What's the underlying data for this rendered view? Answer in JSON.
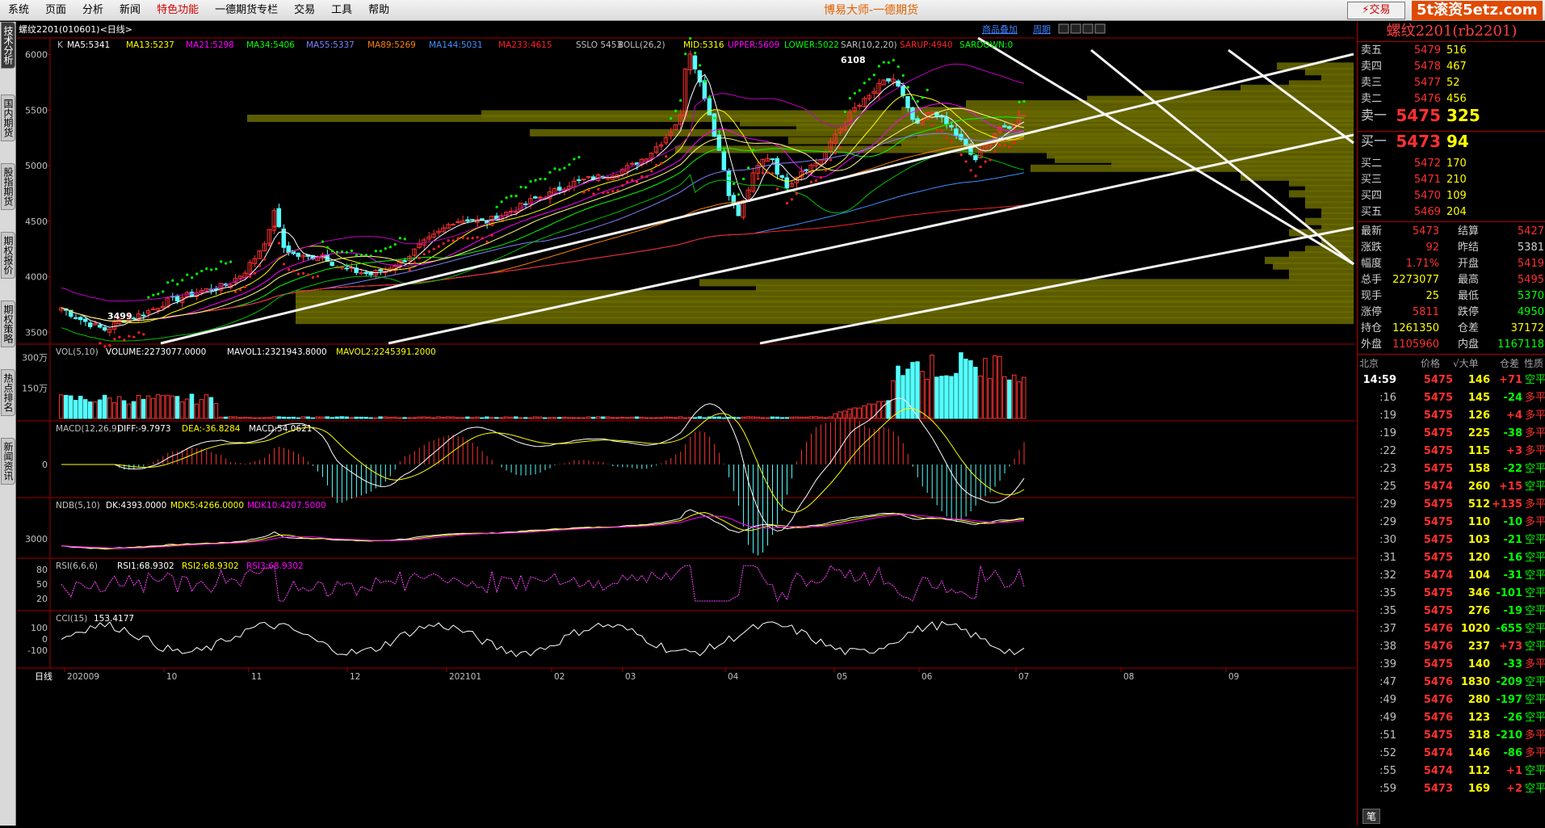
{
  "menu": [
    "系统",
    "页面",
    "分析",
    "新闻",
    "特色功能",
    "一德期货专栏",
    "交易",
    "工具",
    "帮助"
  ],
  "menu_active": 4,
  "app_title": "博易大师-一德期货",
  "trade_button": "⚡交易",
  "watermark": "5t滚资5etz.com",
  "side_tabs": [
    "技术分析",
    "国内期货",
    "股指期货",
    "期权报价",
    "期权策略",
    "热点排名",
    "新闻资讯"
  ],
  "chart": {
    "instrument_label": "螺纹2201(010601)<日线>",
    "toolbar_link": "商品叠加",
    "toolbar_link2": "周期",
    "main_indicator": {
      "k": "K",
      "ma5": "MA5:5341",
      "ma13": "MA13:5237",
      "ma21": "MA21:5298",
      "ma34": "MA34:5406",
      "ma55": "MA55:5337",
      "ma89": "MA89:5269",
      "ma144": "MA144:5031",
      "ma233": "MA233:4615",
      "sslo": "SSLO 5453",
      "boll": "BOLL(26,2)",
      "mid": "MID:5316",
      "upper": "UPPER:5609",
      "lower": "LOWER:5022",
      "sar": "SAR(10,2,20)",
      "sarup": "SARUP:4940",
      "sardown": "SARDOWN:0"
    },
    "high_label": "6108",
    "low_label": "3499",
    "price_axis": [
      "6000",
      "5500",
      "5000",
      "4500",
      "4000",
      "3500"
    ],
    "vol_header": {
      "title": "VOL(5,10)",
      "volume": "VOLUME:2273077.0000",
      "mavol1": "MAVOL1:2321943.8000",
      "mavol2": "MAVOL2:2245391.2000"
    },
    "vol_axis": [
      "300万",
      "150万"
    ],
    "macd_header": {
      "title": "MACD(12,26,9)",
      "diff": "DIFF:-9.7973",
      "dea": "DEA:-36.8284",
      "macd": "MACD:54.0621"
    },
    "macd_axis": [
      "0"
    ],
    "ndb_header": {
      "title": "NDB(5,10)",
      "dk": "DK:4393.0000",
      "mdk5": "MDK5:4266.0000",
      "mdk10": "MDK10:4207.5000"
    },
    "ndb_axis": [
      "3000"
    ],
    "rsi_header": {
      "title": "RSI(6,6,6)",
      "rsi1": "RSI1:68.9302",
      "rsi2": "RSI2:68.9302",
      "rsi3": "RSI3:68.9302"
    },
    "rsi_axis": [
      "80",
      "50",
      "20"
    ],
    "cci_header": {
      "title": "CCI(15)",
      "value": "153.4177"
    },
    "cci_axis": [
      "100",
      "0",
      "-100"
    ],
    "period_label": "日线",
    "date_axis": [
      "202009",
      "10",
      "11",
      "12",
      "202101",
      "02",
      "03",
      "04",
      "05",
      "06",
      "07",
      "08",
      "09"
    ]
  },
  "chart_data": {
    "type": "candlestick",
    "ylim": [
      3400,
      6150
    ],
    "high": 6108,
    "low": 3499,
    "last_close": 5473
  },
  "quote": {
    "title": "螺纹2201(rb2201)",
    "asks": [
      {
        "label": "卖五",
        "price": "5479",
        "vol": "516"
      },
      {
        "label": "卖四",
        "price": "5478",
        "vol": "467"
      },
      {
        "label": "卖三",
        "price": "5477",
        "vol": "52"
      },
      {
        "label": "卖二",
        "price": "5476",
        "vol": "456"
      },
      {
        "label": "卖一",
        "price": "5475",
        "vol": "325"
      }
    ],
    "bids": [
      {
        "label": "买一",
        "price": "5473",
        "vol": "94"
      },
      {
        "label": "买二",
        "price": "5472",
        "vol": "170"
      },
      {
        "label": "买三",
        "price": "5471",
        "vol": "210"
      },
      {
        "label": "买四",
        "price": "5470",
        "vol": "109"
      },
      {
        "label": "买五",
        "price": "5469",
        "vol": "204"
      }
    ],
    "stats": [
      {
        "l1": "最新",
        "v1": "5473",
        "c1": "up",
        "l2": "结算",
        "v2": "5427",
        "c2": "up"
      },
      {
        "l1": "涨跌",
        "v1": "92",
        "c1": "up",
        "l2": "昨结",
        "v2": "5381",
        "c2": "wh"
      },
      {
        "l1": "幅度",
        "v1": "1.71%",
        "c1": "up",
        "l2": "开盘",
        "v2": "5419",
        "c2": "up"
      },
      {
        "l1": "总手",
        "v1": "2273077",
        "c1": "ye",
        "l2": "最高",
        "v2": "5495",
        "c2": "up"
      },
      {
        "l1": "现手",
        "v1": "25",
        "c1": "ye",
        "l2": "最低",
        "v2": "5370",
        "c2": "gr"
      },
      {
        "l1": "涨停",
        "v1": "5811",
        "c1": "up",
        "l2": "跌停",
        "v2": "4950",
        "c2": "gr"
      },
      {
        "l1": "持仓",
        "v1": "1261350",
        "c1": "ye",
        "l2": "仓差",
        "v2": "37172",
        "c2": "ye"
      },
      {
        "l1": "外盘",
        "v1": "1105960",
        "c1": "up",
        "l2": "内盘",
        "v2": "1167118",
        "c2": "gr"
      }
    ],
    "tick_header": {
      "loc": "北京",
      "price": "价格",
      "vol": "√大单",
      "oi": "仓差",
      "nat": "性质"
    },
    "ticks": [
      {
        "t": "14:59",
        "p": "5475",
        "v": "146",
        "o": "+71",
        "n": "空平"
      },
      {
        "t": ":16",
        "p": "5475",
        "v": "145",
        "o": "-24",
        "n": "多平"
      },
      {
        "t": ":19",
        "p": "5475",
        "v": "126",
        "o": "+4",
        "n": "多平"
      },
      {
        "t": ":19",
        "p": "5475",
        "v": "225",
        "o": "-38",
        "n": "多平"
      },
      {
        "t": ":22",
        "p": "5475",
        "v": "115",
        "o": "+3",
        "n": "多平"
      },
      {
        "t": ":23",
        "p": "5475",
        "v": "158",
        "o": "-22",
        "n": "空平"
      },
      {
        "t": ":25",
        "p": "5474",
        "v": "260",
        "o": "+15",
        "n": "空平"
      },
      {
        "t": ":29",
        "p": "5475",
        "v": "512",
        "o": "+135",
        "n": "多平"
      },
      {
        "t": ":29",
        "p": "5475",
        "v": "110",
        "o": "-10",
        "n": "多平"
      },
      {
        "t": ":30",
        "p": "5475",
        "v": "103",
        "o": "-21",
        "n": "空平"
      },
      {
        "t": ":31",
        "p": "5475",
        "v": "120",
        "o": "-16",
        "n": "空平"
      },
      {
        "t": ":32",
        "p": "5474",
        "v": "104",
        "o": "-31",
        "n": "空平"
      },
      {
        "t": ":35",
        "p": "5475",
        "v": "346",
        "o": "-101",
        "n": "空平"
      },
      {
        "t": ":35",
        "p": "5475",
        "v": "276",
        "o": "-19",
        "n": "空平"
      },
      {
        "t": ":37",
        "p": "5476",
        "v": "1020",
        "o": "-655",
        "n": "空平"
      },
      {
        "t": ":38",
        "p": "5476",
        "v": "237",
        "o": "+73",
        "n": "空平"
      },
      {
        "t": ":39",
        "p": "5475",
        "v": "140",
        "o": "-33",
        "n": "多平"
      },
      {
        "t": ":47",
        "p": "5476",
        "v": "1830",
        "o": "-209",
        "n": "空平"
      },
      {
        "t": ":49",
        "p": "5476",
        "v": "280",
        "o": "-197",
        "n": "空平"
      },
      {
        "t": ":49",
        "p": "5476",
        "v": "123",
        "o": "-26",
        "n": "空平"
      },
      {
        "t": ":51",
        "p": "5475",
        "v": "318",
        "o": "-210",
        "n": "多平"
      },
      {
        "t": ":52",
        "p": "5474",
        "v": "146",
        "o": "-86",
        "n": "多平"
      },
      {
        "t": ":55",
        "p": "5474",
        "v": "112",
        "o": "+1",
        "n": "空平"
      },
      {
        "t": ":59",
        "p": "5473",
        "v": "169",
        "o": "+2",
        "n": "空平"
      }
    ],
    "bottom_tab": "笔"
  }
}
